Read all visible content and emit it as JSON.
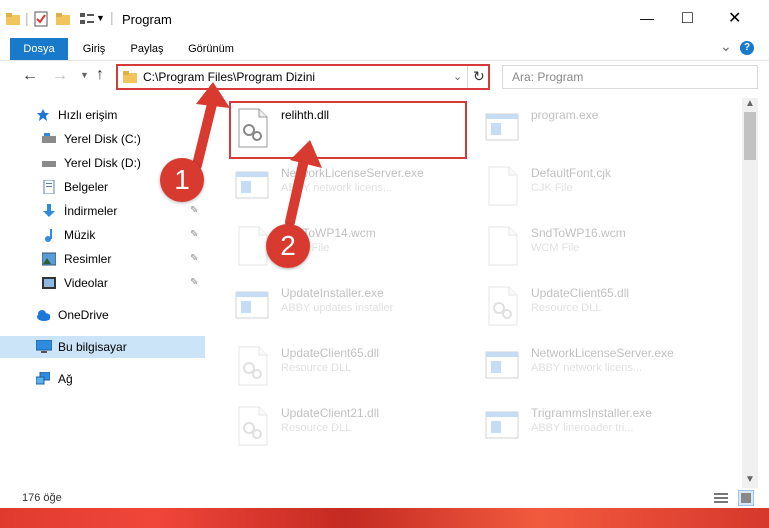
{
  "window": {
    "title": "Program",
    "minimize_symbol": "—",
    "maximize_symbol": "□",
    "close_symbol": "✕"
  },
  "ribbon": {
    "tabs": [
      {
        "label": "Dosya"
      },
      {
        "label": "Giriş"
      },
      {
        "label": "Paylaş"
      },
      {
        "label": "Görünüm"
      }
    ],
    "expand_symbol": "⌄",
    "help_symbol": "?"
  },
  "address": {
    "path": "C:\\Program Files\\Program Dizini",
    "search_placeholder": "Ara: Program"
  },
  "sidebar": {
    "items": [
      {
        "label": "Hızlı erişim",
        "icon": "star-icon"
      },
      {
        "label": "Yerel Disk (C:)",
        "icon": "drive-icon"
      },
      {
        "label": "Yerel Disk (D:)",
        "icon": "drive-icon"
      },
      {
        "label": "Belgeler",
        "icon": "documents-icon"
      },
      {
        "label": "İndirmeler",
        "icon": "download-icon"
      },
      {
        "label": "Müzik",
        "icon": "music-icon"
      },
      {
        "label": "Resimler",
        "icon": "pictures-icon"
      },
      {
        "label": "Videolar",
        "icon": "videos-icon"
      },
      {
        "label": "OneDrive",
        "icon": "cloud-icon"
      },
      {
        "label": "Bu bilgisayar",
        "icon": "computer-icon"
      },
      {
        "label": "Ağ",
        "icon": "network-icon"
      }
    ]
  },
  "files": [
    {
      "name": "relihth.dll",
      "desc": "",
      "faded": false
    },
    {
      "name": "program.exe",
      "desc": "",
      "faded": true
    },
    {
      "name": "NetworkLicenseServer.exe",
      "desc": "ABBY network licens...",
      "faded": true
    },
    {
      "name": "DefaultFont.cjk",
      "desc": "CJK File",
      "faded": true
    },
    {
      "name": "SndToWP14.wcm",
      "desc": "WCM File",
      "faded": true
    },
    {
      "name": "SndToWP16.wcm",
      "desc": "WCM File",
      "faded": true
    },
    {
      "name": "UpdateInstaller.exe",
      "desc": "ABBY updates installer",
      "faded": true
    },
    {
      "name": "UpdateClient65.dll",
      "desc": "Resource DLL",
      "faded": true
    },
    {
      "name": "UpdateClient65.dll",
      "desc": "Resource DLL",
      "faded": true
    },
    {
      "name": "NetworkLicenseServer.exe",
      "desc": "ABBY network licens...",
      "faded": true
    },
    {
      "name": "UpdateClient21.dll",
      "desc": "Resource DLL",
      "faded": true
    },
    {
      "name": "TrigrammsInstaller.exe",
      "desc": "ABBY lineroader tri...",
      "faded": true
    }
  ],
  "status": {
    "count": "176 öğe"
  },
  "markers": {
    "one": "1",
    "two": "2"
  }
}
